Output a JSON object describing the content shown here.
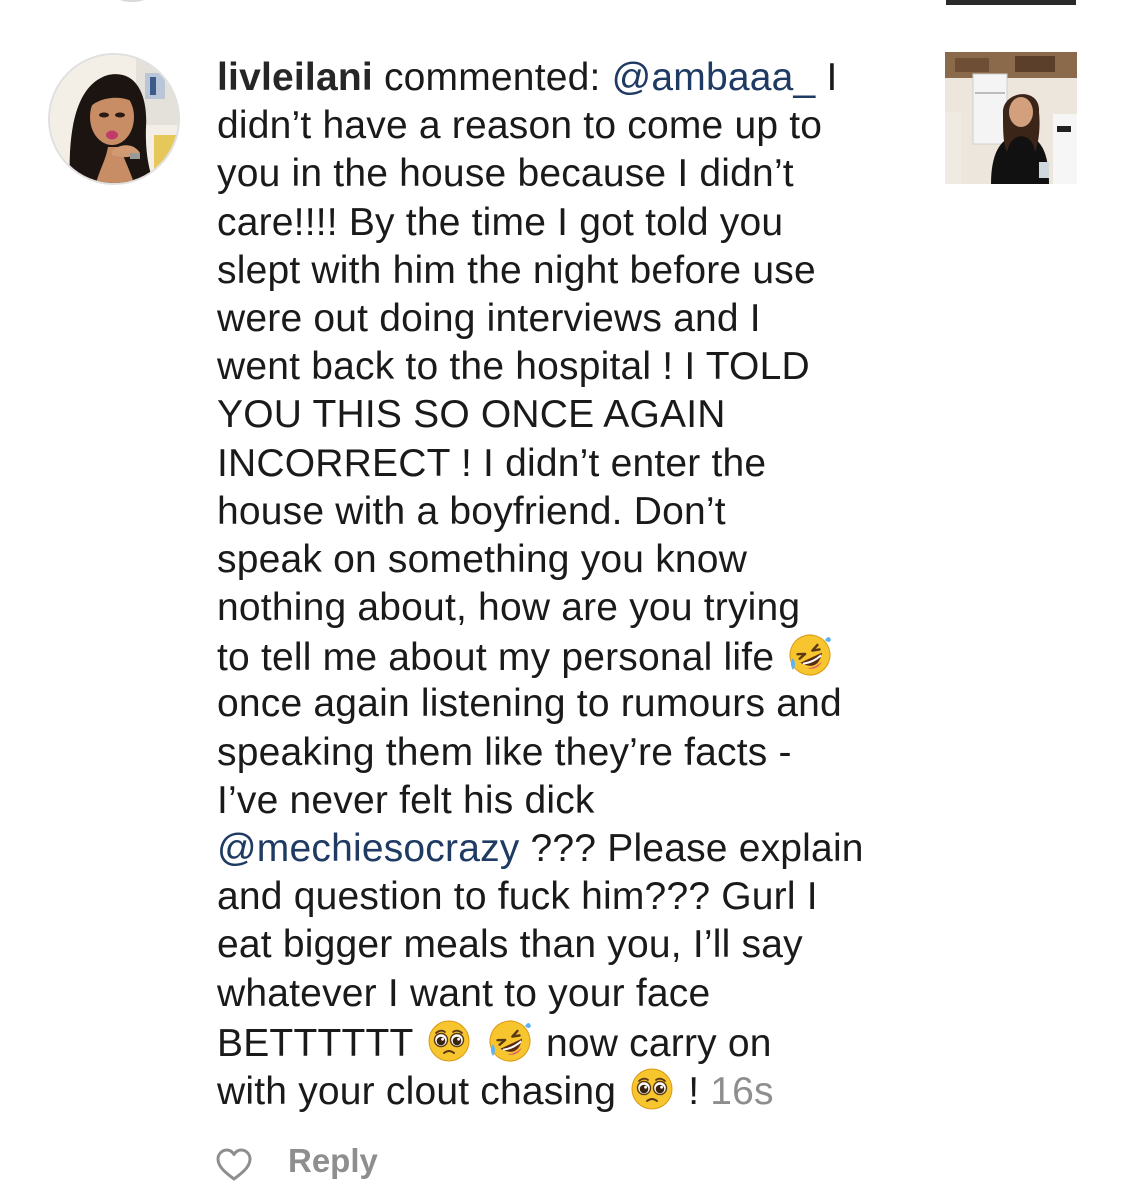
{
  "comment": {
    "username": "livleilani",
    "lines": [
      [
        {
          "t": "commented: ",
          "k": "text"
        },
        {
          "t": "@ambaaa_",
          "k": "mention"
        },
        {
          "t": " I",
          "k": "text"
        }
      ],
      [
        {
          "t": "didn’t have a reason to come up to",
          "k": "text"
        }
      ],
      [
        {
          "t": "you in the house because I didn’t",
          "k": "text"
        }
      ],
      [
        {
          "t": "care!!!! By the time I got told you",
          "k": "text"
        }
      ],
      [
        {
          "t": "slept with him the night before use",
          "k": "text"
        }
      ],
      [
        {
          "t": "were out doing interviews and I",
          "k": "text"
        }
      ],
      [
        {
          "t": "went back to the hospital ! I TOLD",
          "k": "text"
        }
      ],
      [
        {
          "t": "YOU THIS SO ONCE AGAIN",
          "k": "text"
        }
      ],
      [
        {
          "t": "INCORRECT ! I didn’t enter the",
          "k": "text"
        }
      ],
      [
        {
          "t": "house with a boyfriend. Don’t",
          "k": "text"
        }
      ],
      [
        {
          "t": "speak on something you know",
          "k": "text"
        }
      ],
      [
        {
          "t": "nothing about, how are you trying",
          "k": "text"
        }
      ],
      [
        {
          "t": "to tell me about my personal life ",
          "k": "text"
        },
        {
          "t": "rofl-emoji",
          "k": "emoji"
        }
      ],
      [
        {
          "t": "once again listening to rumours and",
          "k": "text"
        }
      ],
      [
        {
          "t": "speaking them like they’re facts -",
          "k": "text"
        }
      ],
      [
        {
          "t": "I’ve never felt his dick",
          "k": "text"
        }
      ],
      [
        {
          "t": "@mechiesocrazy",
          "k": "mention"
        },
        {
          "t": " ??? Please explain",
          "k": "text"
        }
      ],
      [
        {
          "t": "and question to fuck him??? Gurl I",
          "k": "text"
        }
      ],
      [
        {
          "t": "eat bigger meals than you, I’ll say",
          "k": "text"
        }
      ],
      [
        {
          "t": "whatever I want to your face",
          "k": "text"
        }
      ],
      [
        {
          "t": "BETTTTTT ",
          "k": "text"
        },
        {
          "t": "pleading-face-emoji",
          "k": "emoji"
        },
        {
          "t": " ",
          "k": "text"
        },
        {
          "t": "rofl-emoji",
          "k": "emoji"
        },
        {
          "t": " now carry on",
          "k": "text"
        }
      ],
      [
        {
          "t": "with your clout chasing ",
          "k": "text"
        },
        {
          "t": "pleading-face-emoji",
          "k": "emoji"
        },
        {
          "t": " ! ",
          "k": "text"
        },
        {
          "t": "16s",
          "k": "time"
        }
      ]
    ]
  },
  "actions": {
    "like_icon": "heart-outline-icon",
    "reply_label": "Reply"
  },
  "colors": {
    "text": "#1a1a1a",
    "mention": "#1f3b63",
    "muted": "#8e8e8e"
  }
}
